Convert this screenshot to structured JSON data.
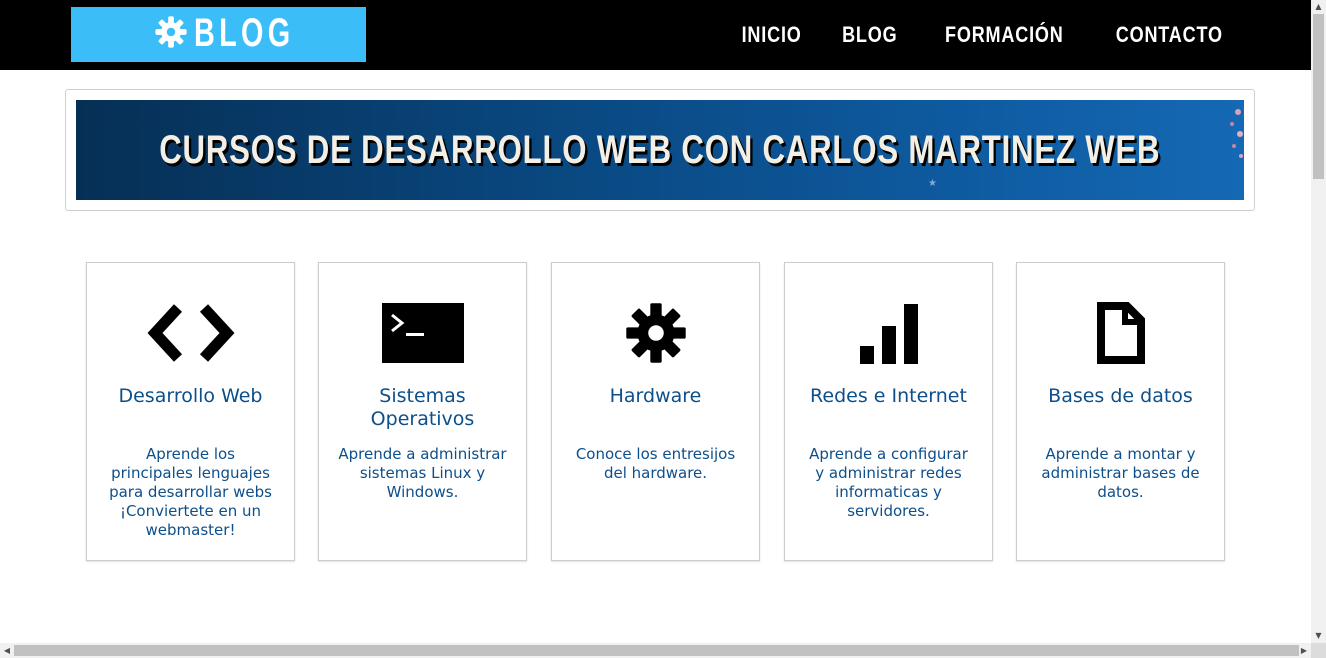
{
  "header": {
    "logo_text": "BLOG",
    "logo_icon": "gear-icon",
    "nav": [
      "INICIO",
      "BLOG",
      "FORMACIÓN",
      "CONTACTO"
    ]
  },
  "banner": {
    "title": "CURSOS DE DESARROLLO WEB CON CARLOS MARTINEZ WEB"
  },
  "cards": [
    {
      "icon": "code-icon",
      "title": "Desarrollo Web",
      "description": "Aprende los principales lenguajes para desarrollar webs ¡Conviertete en un webmaster!"
    },
    {
      "icon": "terminal-icon",
      "title": "Sistemas Operativos",
      "description": "Aprende a administrar sistemas Linux y Windows."
    },
    {
      "icon": "gear-icon",
      "title": "Hardware",
      "description": "Conoce los entresijos del hardware."
    },
    {
      "icon": "signal-bars-icon",
      "title": "Redes e Internet",
      "description": "Aprende a configurar y administrar redes informaticas y servidores."
    },
    {
      "icon": "document-icon",
      "title": "Bases de datos",
      "description": "Aprende a montar y administrar bases de datos."
    }
  ],
  "colors": {
    "header_bg": "#000000",
    "logo_bg": "#3bbdf8",
    "banner_bg": "#0a4a84",
    "card_text": "#0d4f8b"
  }
}
